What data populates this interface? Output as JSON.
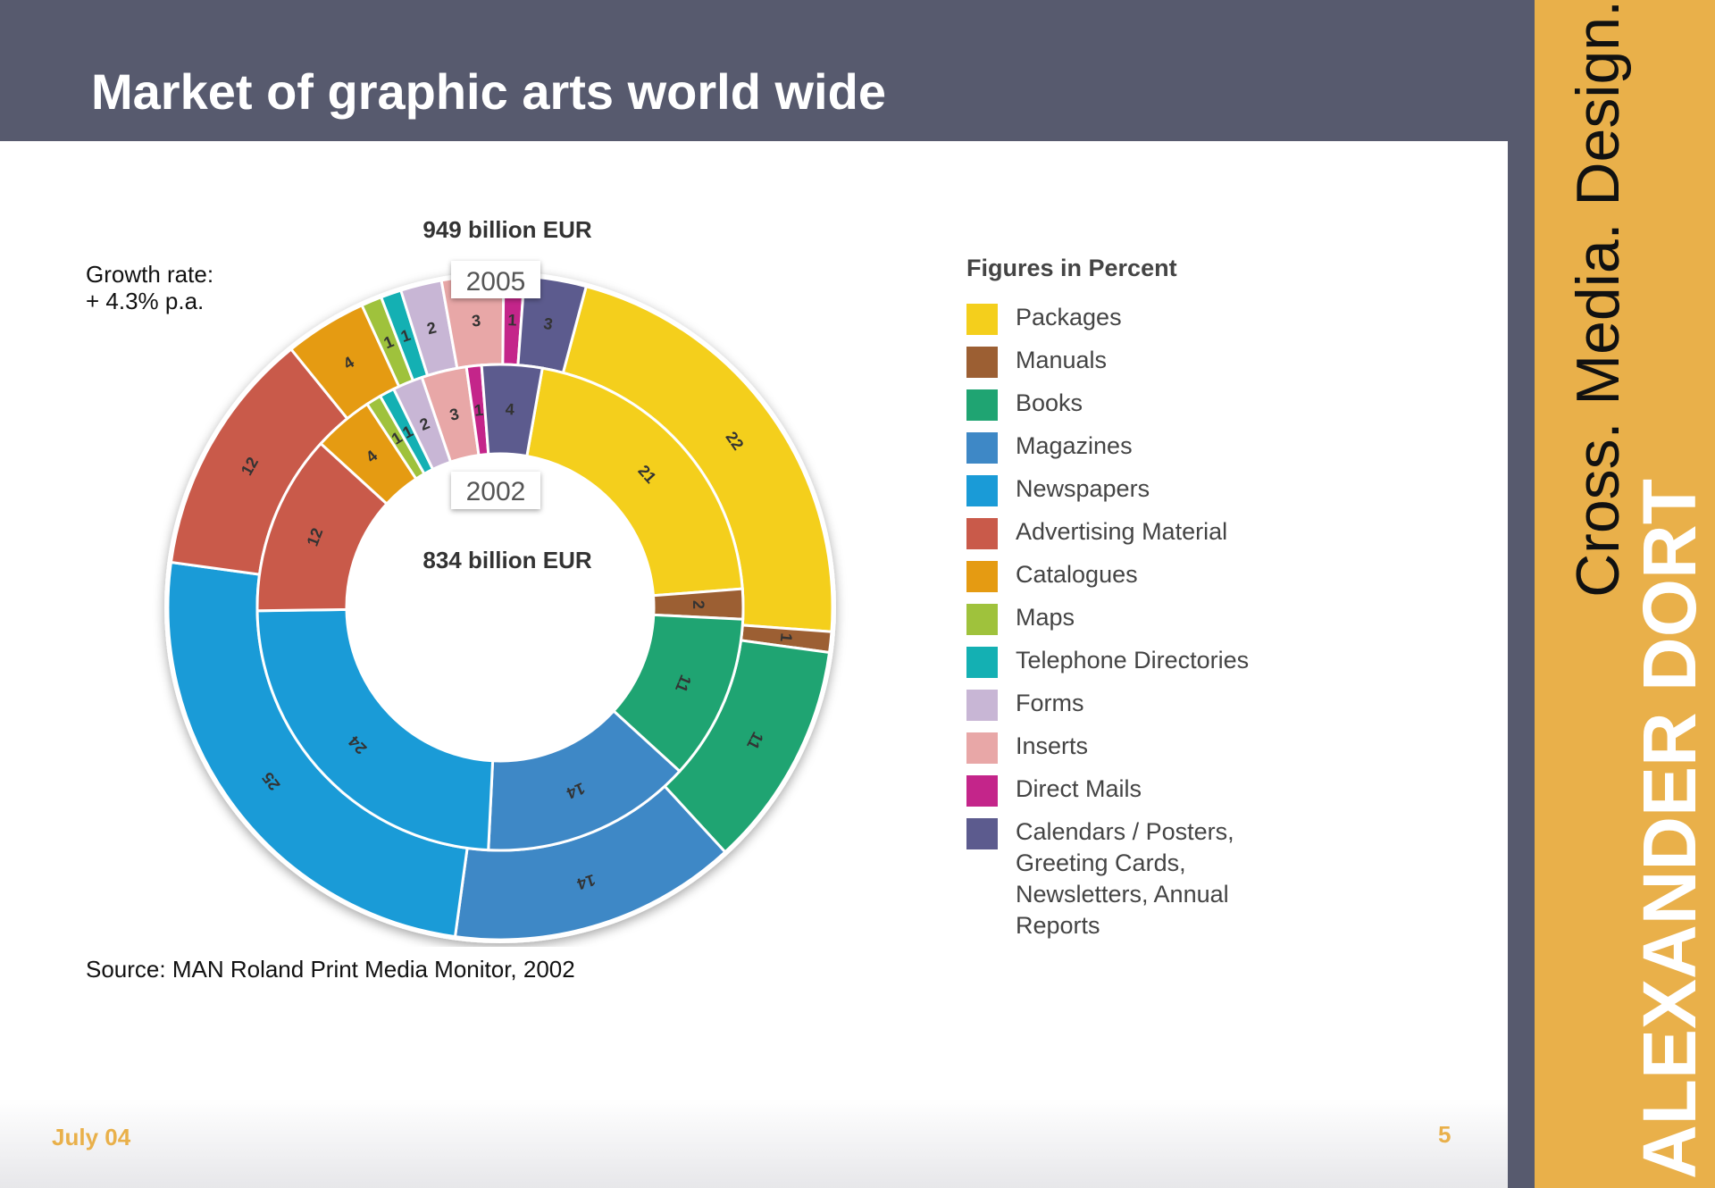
{
  "slide": {
    "title": "Market of graphic arts world wide",
    "growth_rate_label": "Growth rate:",
    "growth_rate_value": "+ 4.3% p.a.",
    "source": "Source: MAN Roland Print Media Monitor, 2002",
    "date": "July 04",
    "page_number": "5"
  },
  "brand": {
    "name": "ALEXANDER DORT",
    "tagline": "Cross. Media. Design."
  },
  "colors": {
    "header_bar": "#575a6e",
    "accent_panel": "#e9b04a"
  },
  "chart_data": {
    "type": "pie",
    "variant": "nested-donut",
    "legend_title": "Figures in Percent",
    "legend_placement": "right",
    "categories": [
      {
        "name": "Packages",
        "color": "#f4cf1c"
      },
      {
        "name": "Manuals",
        "color": "#9c5f33"
      },
      {
        "name": "Books",
        "color": "#1fa472"
      },
      {
        "name": "Magazines",
        "color": "#3e88c6"
      },
      {
        "name": "Newspapers",
        "color": "#1a9bd7"
      },
      {
        "name": "Advertising Material",
        "color": "#c95a4a"
      },
      {
        "name": "Catalogues",
        "color": "#e59b12"
      },
      {
        "name": "Maps",
        "color": "#9fc23c"
      },
      {
        "name": "Telephone Directories",
        "color": "#14b0b3"
      },
      {
        "name": "Forms",
        "color": "#c8b6d5"
      },
      {
        "name": "Inserts",
        "color": "#e8a7a7"
      },
      {
        "name": "Direct Mails",
        "color": "#c4258a"
      },
      {
        "name": "Calendars / Posters, Greeting Cards, Newsletters, Annual Reports",
        "color": "#5c5b8e"
      }
    ],
    "series": [
      {
        "name": "2005",
        "total": "949 billion EUR",
        "ring": "outer",
        "slices": [
          {
            "category": "Packages",
            "value": 22
          },
          {
            "category": "Manuals",
            "value": 1
          },
          {
            "category": "Books",
            "value": 11
          },
          {
            "category": "Magazines",
            "value": 14
          },
          {
            "category": "Newspapers",
            "value": 25
          },
          {
            "category": "Advertising Material",
            "value": 12
          },
          {
            "category": "Catalogues",
            "value": 4
          },
          {
            "category": "Maps",
            "value": 1
          },
          {
            "category": "Telephone Directories",
            "value": 1
          },
          {
            "category": "Forms",
            "value": 2
          },
          {
            "category": "Inserts",
            "value": 3
          },
          {
            "category": "Direct Mails",
            "value": 1
          },
          {
            "category": "Calendars / Posters, Greeting Cards, Newsletters, Annual Reports",
            "value": 3
          }
        ]
      },
      {
        "name": "2002",
        "total": "834 billion EUR",
        "ring": "inner",
        "slices": [
          {
            "category": "Packages",
            "value": 21
          },
          {
            "category": "Manuals",
            "value": 2
          },
          {
            "category": "Books",
            "value": 11
          },
          {
            "category": "Magazines",
            "value": 14
          },
          {
            "category": "Newspapers",
            "value": 24
          },
          {
            "category": "Advertising Material",
            "value": 12
          },
          {
            "category": "Catalogues",
            "value": 4
          },
          {
            "category": "Maps",
            "value": 1
          },
          {
            "category": "Telephone Directories",
            "value": 1
          },
          {
            "category": "Forms",
            "value": 2
          },
          {
            "category": "Inserts",
            "value": 3
          },
          {
            "category": "Direct Mails",
            "value": 1
          },
          {
            "category": "Calendars / Posters, Greeting Cards, Newsletters, Annual Reports",
            "value": 4
          }
        ]
      }
    ]
  }
}
